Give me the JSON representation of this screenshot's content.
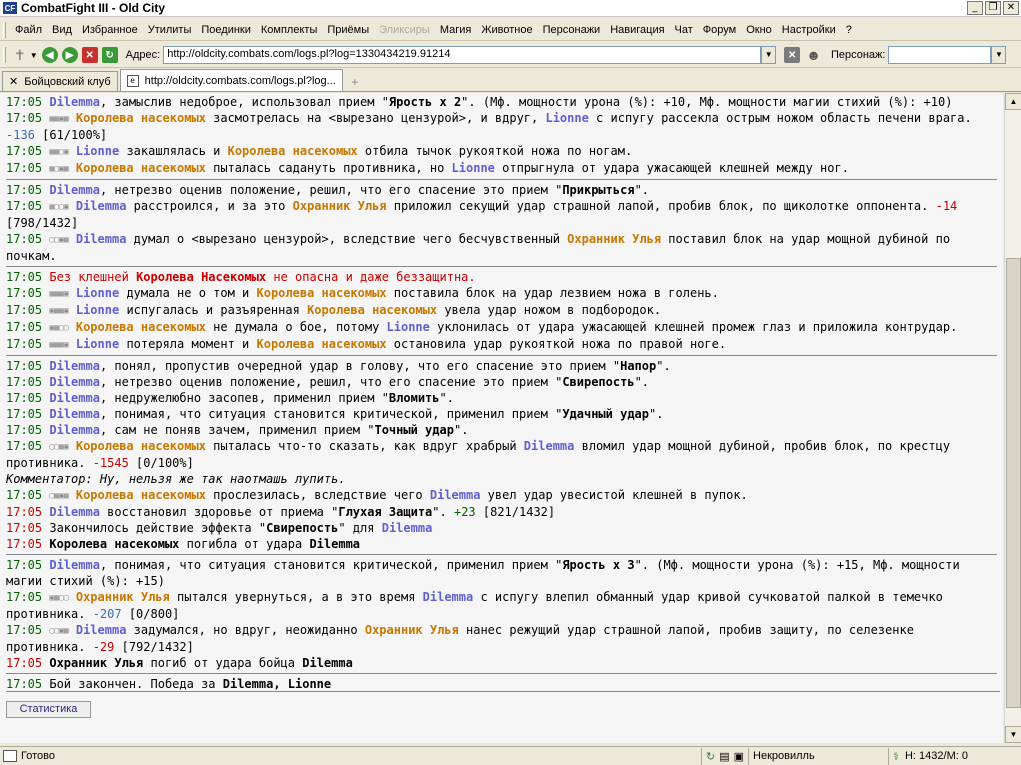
{
  "window": {
    "title": "CombatFight III - Old City",
    "icon_text": "CF"
  },
  "menu": [
    "Файл",
    "Вид",
    "Избранное",
    "Утилиты",
    "Поединки",
    "Комплекты",
    "Приёмы",
    "Эликсиры",
    "Магия",
    "Животное",
    "Персонажи",
    "Навигация",
    "Чат",
    "Форум",
    "Окно",
    "Настройки",
    "?"
  ],
  "address": {
    "label": "Адрес:",
    "url": "http://oldcity.combats.com/logs.pl?log=1330434219.91214",
    "persona_label": "Персонаж:"
  },
  "tabs": [
    {
      "label": "Бойцовский клуб"
    },
    {
      "label": "http://oldcity.combats.com/logs.pl?log..."
    }
  ],
  "log": {
    "l1": {
      "time": "17:05",
      "who": "Dilemma",
      "text": ", замыслив недоброе, использовал прием \"",
      "skill": "Ярость x 2",
      "rest": "\". (Мф. мощности урона (%): +10, Мф. мощности магии стихий (%): +10)"
    },
    "l2": {
      "time": "17:05",
      "who": "Королева насекомых",
      "t1": " засмотрелась на <вырезано цензурой>, и вдруг, ",
      "who2": "Lionne",
      "t2": " с испугу рассекла острым ножом область печени врага. ",
      "dmg": "-136",
      "hp": " [61/100%]"
    },
    "l3": {
      "time": "17:05",
      "who": "Lionne",
      "t1": " закашлялась и ",
      "who2": "Королева насекомых",
      "t2": " отбила тычок рукояткой ножа по ногам."
    },
    "l4": {
      "time": "17:05",
      "who": "Королева насекомых",
      "t1": " пыталась садануть противника, но ",
      "who2": "Lionne",
      "t2": " отпрыгнула от удара ужасающей клешней между ног."
    },
    "l5": {
      "time": "17:05",
      "who": "Dilemma",
      "t1": ", нетрезво оценив положение, решил, что его спасение это прием \"",
      "skill": "Прикрыться",
      "t2": "\"."
    },
    "l6": {
      "time": "17:05",
      "who": "Dilemma",
      "t1": " расстроился, и за это ",
      "who2": "Охранник Улья",
      "t2": " приложил секущий удар страшной лапой, пробив блок, по щиколотке оппонента. ",
      "dmg": "-14",
      "hp": " [798/1432]"
    },
    "l7": {
      "time": "17:05",
      "who": "Dilemma",
      "t1": " думал о <вырезано цензурой>, вследствие чего бесчувственный ",
      "who2": "Охранник Улья",
      "t2": " поставил блок на удар мощной дубиной по почкам."
    },
    "l8": {
      "time": "17:05",
      "t1": "Без клешней ",
      "who": "Королева Насекомых",
      "t2": " не опасна и даже беззащитна."
    },
    "l9": {
      "time": "17:05",
      "who": "Lionne",
      "t1": " думала не о том и ",
      "who2": "Королева насекомых",
      "t2": " поставила блок на удар лезвием ножа в голень."
    },
    "l10": {
      "time": "17:05",
      "who": "Lionne",
      "t1": " испугалась и разъяренная ",
      "who2": "Королева насекомых",
      "t2": " увела удар ножом в подбородок."
    },
    "l11": {
      "time": "17:05",
      "who": "Королева насекомых",
      "t1": " не думала о бое, потому ",
      "who2": "Lionne",
      "t2": " уклонилась от удара ужасающей клешней промеж глаз и приложила контрудар."
    },
    "l12": {
      "time": "17:05",
      "who": "Lionne",
      "t1": " потеряла момент и ",
      "who2": "Королева насекомых",
      "t2": " остановила удар рукояткой ножа по правой ноге."
    },
    "l13": {
      "time": "17:05",
      "who": "Dilemma",
      "t1": ", понял, пропустив очередной удар в голову, что его спасение это прием \"",
      "skill": "Напор",
      "t2": "\"."
    },
    "l14": {
      "time": "17:05",
      "who": "Dilemma",
      "t1": ", нетрезво оценив положение, решил, что его спасение это прием \"",
      "skill": "Свирепость",
      "t2": "\"."
    },
    "l15": {
      "time": "17:05",
      "who": "Dilemma",
      "t1": ", недружелюбно засопев, применил прием \"",
      "skill": "Вломить",
      "t2": "\"."
    },
    "l16": {
      "time": "17:05",
      "who": "Dilemma",
      "t1": ", понимая, что ситуация становится критической, применил прием \"",
      "skill": "Удачный удар",
      "t2": "\"."
    },
    "l17": {
      "time": "17:05",
      "who": "Dilemma",
      "t1": ", сам не поняв зачем, применил прием \"",
      "skill": "Точный удар",
      "t2": "\"."
    },
    "l18": {
      "time": "17:05",
      "who": "Королева насекомых",
      "t1": " пыталась что-то сказать, как вдруг храбрый ",
      "who2": "Dilemma",
      "t2": " вломил удар мощной дубиной, пробив блок, по крестцу противника. ",
      "dmg": "-1545",
      "hp": " [0/100%]"
    },
    "l19": {
      "text": "Комментатор: Ну, нельзя же так наотмашь лупить."
    },
    "l20": {
      "time": "17:05",
      "who": "Королева насекомых",
      "t1": " прослезилась, вследствие чего ",
      "who2": "Dilemma",
      "t2": " увел удар увесистой клешней в пупок."
    },
    "l21": {
      "time": "17:05",
      "who": "Dilemma",
      "t1": " восстановил здоровье от приема \"",
      "skill": "Глухая Защита",
      "t2": "\". ",
      "heal": "+23",
      "hp": " [821/1432]"
    },
    "l22": {
      "time": "17:05",
      "t1": "Закончилось действие эффекта \"",
      "skill": "Свирепость",
      "t2": "\" для ",
      "who": "Dilemma"
    },
    "l23": {
      "time": "17:05",
      "who": "Королева насекомых",
      "t1": " погибла от удара ",
      "who2": "Dilemma"
    },
    "l24": {
      "time": "17:05",
      "who": "Dilemma",
      "t1": ", понимая, что ситуация становится критической, применил прием \"",
      "skill": "Ярость x 3",
      "t2": "\". (Мф. мощности урона (%): +15, Мф. мощности магии стихий (%): +15)"
    },
    "l25": {
      "time": "17:05",
      "who": "Охранник Улья",
      "t1": " пытался увернуться, а в это время ",
      "who2": "Dilemma",
      "t2": " с испугу влепил обманный удар кривой сучковатой палкой в темечко противника. ",
      "dmg": "-207",
      "hp": " [0/800]"
    },
    "l26": {
      "time": "17:05",
      "who": "Dilemma",
      "t1": " задумался, но вдруг, неожиданно ",
      "who2": "Охранник Улья",
      "t2": " нанес режущий удар страшной лапой, пробив защиту, по селезенке противника. ",
      "dmg": "-29",
      "hp": " [792/1432]"
    },
    "l27": {
      "time": "17:05",
      "who": "Охранник Улья",
      "t1": " погиб от удара бойца ",
      "who2": "Dilemma"
    },
    "l28": {
      "time": "17:05",
      "t1": "Бой закончен. Победа за ",
      "who": "Dilemma, Lionne"
    }
  },
  "stats_button": "Статистика",
  "status": {
    "text": "Готово",
    "location": "Некровилль",
    "hp": "Н: 1432/М: 0"
  }
}
